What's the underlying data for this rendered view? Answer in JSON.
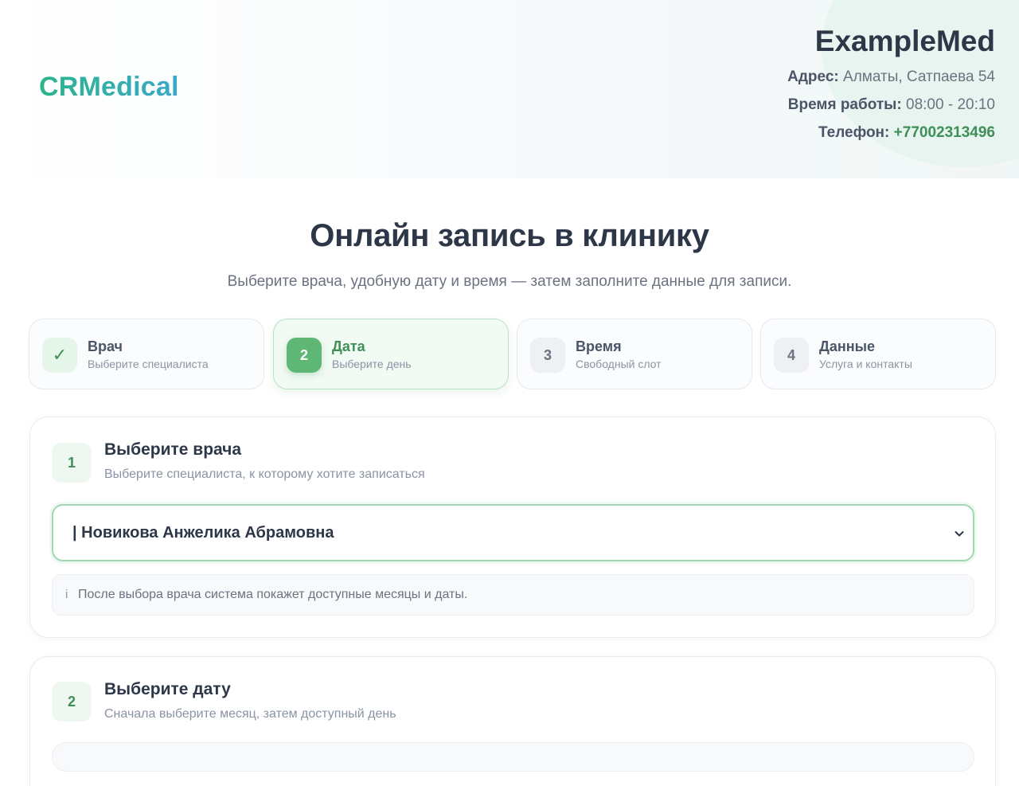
{
  "brand": {
    "logo": "CRMedical"
  },
  "clinic": {
    "name": "ExampleMed",
    "address_label": "Адрес:",
    "address_value": "Алматы, Сатпаева 54",
    "hours_label": "Время работы:",
    "hours_value": "08:00 - 20:10",
    "phone_label": "Телефон:",
    "phone_value": "+77002313496"
  },
  "page": {
    "title": "Онлайн запись в клинику",
    "subtitle": "Выберите врача, удобную дату и время — затем заполните данные для записи."
  },
  "steps": [
    {
      "badge": "✓",
      "title": "Врач",
      "subtitle": "Выберите специалиста",
      "state": "done"
    },
    {
      "badge": "2",
      "title": "Дата",
      "subtitle": "Выберите день",
      "state": "active"
    },
    {
      "badge": "3",
      "title": "Время",
      "subtitle": "Свободный слот",
      "state": "pending"
    },
    {
      "badge": "4",
      "title": "Данные",
      "subtitle": "Услуга и контакты",
      "state": "pending"
    }
  ],
  "doctor_section": {
    "number": "1",
    "title": "Выберите врача",
    "subtitle": "Выберите специалиста, к которому хотите записаться",
    "selected_doctor": "| Новикова Анжелика Абрамовна",
    "info_icon": "i",
    "info_text": "После выбора врача система покажет доступные месяцы и даты."
  },
  "date_section": {
    "number": "2",
    "title": "Выберите дату",
    "subtitle": "Сначала выберите месяц, затем доступный день"
  },
  "colors": {
    "accent_green": "#5fb776",
    "brand_gradient_start": "#2bb48a",
    "brand_gradient_end": "#3aa9c9",
    "phone": "#3f8f57"
  }
}
